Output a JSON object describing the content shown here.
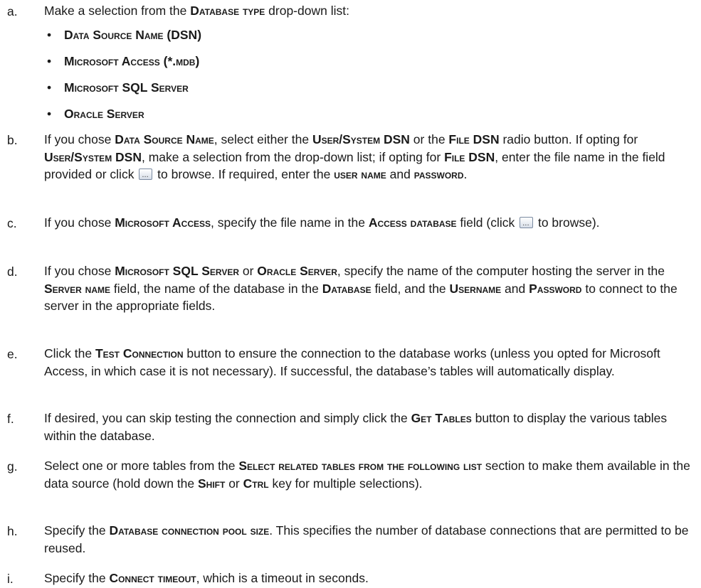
{
  "steps": {
    "a": {
      "letter": "a.",
      "text_1": "Make a selection from the ",
      "sc_1": "Database type",
      "text_2": " drop-down list:",
      "bullets": [
        {
          "symbol": "•",
          "text": "Data Source Name (DSN)"
        },
        {
          "symbol": "•",
          "text": "Microsoft Access (*.mdb)"
        },
        {
          "symbol": "•",
          "text": "Microsoft SQL Server"
        },
        {
          "symbol": "•",
          "text": "Oracle Server"
        }
      ]
    },
    "b": {
      "letter": "b.",
      "t1": "If you chose ",
      "s1": "Data Source Name",
      "t2": ", select either the ",
      "s2": "User/System DSN",
      "t3": " or the ",
      "s3": "File DSN",
      "t4": " radio button. If opting for ",
      "s4": "User/System DSN",
      "t5": ", make a selection from the drop-down list; if opting for ",
      "s5": "File DSN",
      "t6": ", enter the file name in the field provided or click ",
      "t7": " to browse. If required, enter the ",
      "s6": "user name",
      "t8": " and ",
      "s7": "password",
      "t9": "."
    },
    "c": {
      "letter": "c.",
      "t1": "If you chose ",
      "s1": "Microsoft Access",
      "t2": ", specify the file name in the ",
      "s2": "Access database",
      "t3": " field (click ",
      "t4": " to browse)."
    },
    "d": {
      "letter": "d.",
      "t1": "If you chose ",
      "s1": "Microsoft SQL Server",
      "t2": " or ",
      "s2": "Oracle Server",
      "t3": ", specify the name of the computer hosting the server in the ",
      "s3": "Server name",
      "t4": " field, the name of the database in the ",
      "s4": "Database",
      "t5": " field, and the ",
      "s5": "Username",
      "t6": " and ",
      "s6": "Password",
      "t7": " to connect to the server in the appropriate fields."
    },
    "e": {
      "letter": "e.",
      "t1": "Click the ",
      "s1": "Test Connection",
      "t2": " button to ensure the connection to the database works (unless you opted for Microsoft Access, in which case it is not necessary). If successful, the database’s tables will automatically display."
    },
    "f": {
      "letter": "f.",
      "t1": "If desired, you can skip testing the connection and simply click the ",
      "s1": "Get Tables",
      "t2": " button to display the various tables within the database."
    },
    "g": {
      "letter": "g.",
      "t1": "Select one or more tables from the ",
      "s1": "Select related tables from the following list",
      "t2": " section to make them available in the data source (hold down the ",
      "s2": "Shift",
      "t3": " or ",
      "s3": "Ctrl",
      "t4": " key for multiple selections)."
    },
    "h": {
      "letter": "h.",
      "t1": "Specify the ",
      "s1": "Database connection pool size",
      "t2": ". This specifies the number of database connections that are permitted to be reused."
    },
    "i": {
      "letter": "i.",
      "t1": "Specify the ",
      "s1": "Connect timeout",
      "t2": ", which is a timeout in seconds."
    }
  }
}
